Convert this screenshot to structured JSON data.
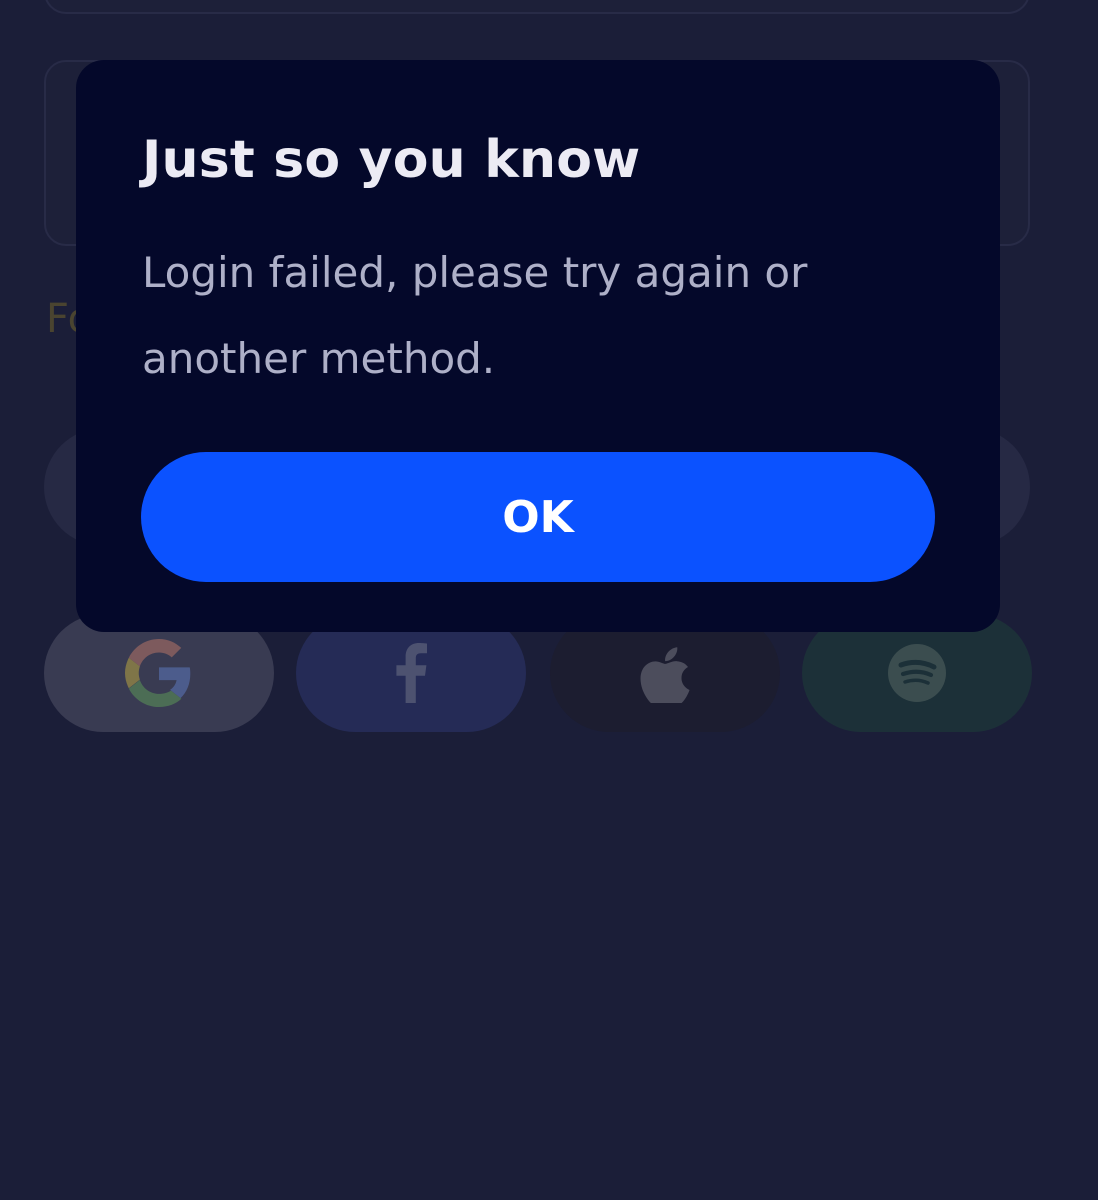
{
  "background": {
    "forgot_link_fragment": "Fo",
    "social_buttons": [
      {
        "name": "google",
        "icon": "google-icon"
      },
      {
        "name": "facebook",
        "icon": "facebook-icon"
      },
      {
        "name": "apple",
        "icon": "apple-icon"
      },
      {
        "name": "spotify",
        "icon": "spotify-icon"
      }
    ]
  },
  "dialog": {
    "title": "Just so you know",
    "message": "Login failed, please try again or another method.",
    "ok_label": "OK"
  },
  "colors": {
    "background": "#1b1e38",
    "dialog_background": "#04082a",
    "primary_button": "#0b52ff",
    "title_text": "#ecebf4",
    "message_text": "#aeb0c8"
  }
}
